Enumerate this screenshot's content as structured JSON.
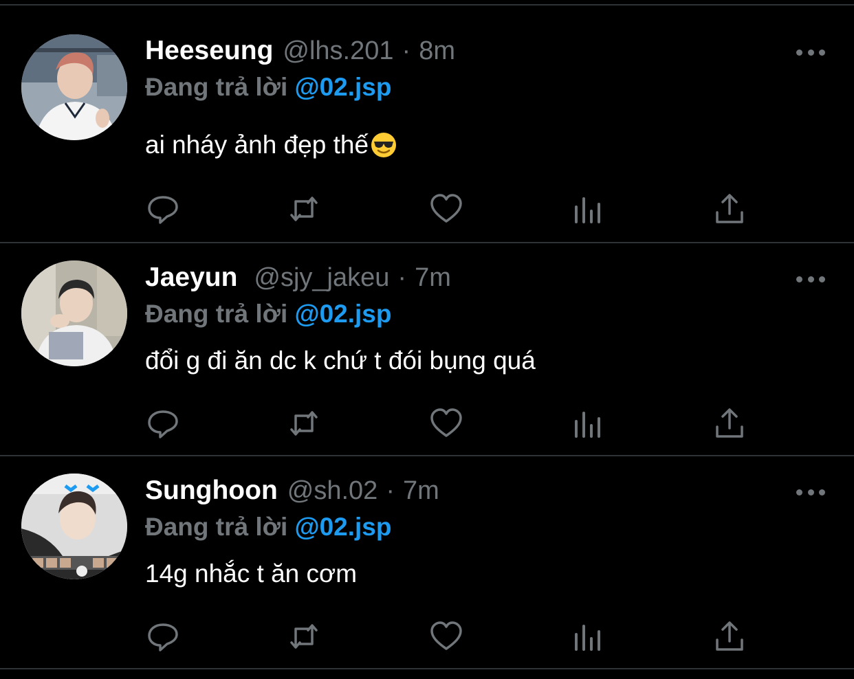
{
  "tweets": [
    {
      "name": "Heeseung",
      "handle": "@lhs.201",
      "separator": "·",
      "time": "8m",
      "reply_prefix": "Đang trả lời",
      "reply_mention": "@02.jsp",
      "text": "ai nháy ảnh đẹp thế",
      "emoji": "smiling-face-with-sunglasses"
    },
    {
      "name": "Jaeyun",
      "handle": "@sjy_jakeu",
      "separator": "·",
      "time": "7m",
      "reply_prefix": "Đang trả lời",
      "reply_mention": "@02.jsp",
      "text": "đổi g đi ăn dc k chứ t đói bụng quá"
    },
    {
      "name": "Sunghoon",
      "handle": "@sh.02",
      "separator": "·",
      "time": "7m",
      "reply_prefix": "Đang trả lời",
      "reply_mention": "@02.jsp",
      "text": "14g nhắc t ăn cơm"
    }
  ],
  "actions": [
    "reply-icon",
    "retweet-icon",
    "like-icon",
    "analytics-icon",
    "share-icon"
  ],
  "colors": {
    "background": "#000000",
    "name": "#ffffff",
    "secondary": "#71767b",
    "mention": "#1d9bf0",
    "divider": "#2f3336"
  }
}
